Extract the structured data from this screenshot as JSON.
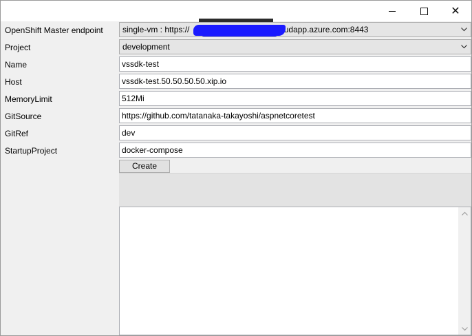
{
  "window": {
    "controls": {
      "minimize_icon": "minimize-icon",
      "maximize_icon": "maximize-icon",
      "close_icon": "close-icon",
      "close_glyph": "✕"
    }
  },
  "form": {
    "labels": {
      "endpoint": "OpenShift Master endpoint",
      "project": "Project",
      "name": "Name",
      "host": "Host",
      "memory_limit": "MemoryLimit",
      "git_source": "GitSource",
      "git_ref": "GitRef",
      "startup_project": "StartupProject"
    },
    "values": {
      "endpoint_prefix": "single-vm : https://",
      "endpoint_suffix": "cloudapp.azure.com:8443",
      "project": "development",
      "name": "vssdk-test",
      "host": "vssdk-test.50.50.50.50.xip.io",
      "memory_limit": "512Mi",
      "git_source": "https://github.com/tatanaka-takayoshi/aspnetcoretest",
      "git_ref": "dev",
      "startup_project": "docker-compose"
    },
    "create_label": "Create"
  },
  "output": {
    "text": ""
  },
  "colors": {
    "window_bg": "#f0f0f0",
    "combo_bg": "#e5e5e5",
    "button_bg": "#e1e1e1",
    "redaction": "#1a1aff"
  }
}
